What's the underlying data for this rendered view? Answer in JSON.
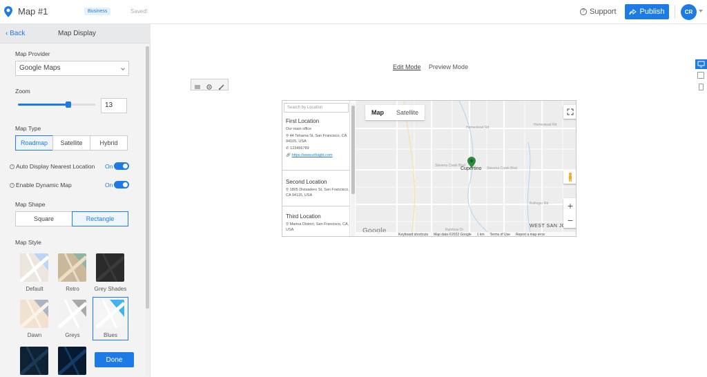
{
  "topbar": {
    "title": "Map #1",
    "badge": "Business",
    "status": "Saved!",
    "support_label": "Support",
    "publish_label": "Publish",
    "avatar_initials": "CR",
    "accent_color": "#1e7be5"
  },
  "sidebar": {
    "back_label": "‹ Back",
    "title": "Map Display",
    "map_provider_label": "Map Provider",
    "map_provider_value": "Google Maps",
    "zoom_label": "Zoom",
    "zoom_value": "13",
    "zoom_slider_fraction": 0.63,
    "map_type_label": "Map Type",
    "map_types": [
      "Roadmap",
      "Satellite",
      "Hybrid"
    ],
    "map_type_selected": "Roadmap",
    "auto_nearest_label": "Auto Display Nearest Location",
    "auto_nearest_state": "On",
    "dynamic_map_label": "Enable Dynamic Map",
    "dynamic_map_state": "On",
    "map_shape_label": "Map Shape",
    "map_shapes": [
      "Square",
      "Rectangle"
    ],
    "map_shape_selected": "Rectangle",
    "map_style_label": "Map Style",
    "styles": [
      "Default",
      "Retro",
      "Grey Shades",
      "Dawn",
      "Greys",
      "Blues"
    ],
    "style_selected": "Blues",
    "done_label": "Done"
  },
  "canvas": {
    "edit_mode_label": "Edit Mode",
    "preview_mode_label": "Preview Mode"
  },
  "locations": {
    "search_placeholder": "Search by Location",
    "items": [
      {
        "name": "First Location",
        "desc": "Our main office",
        "address": "44 Tehama St, San Francisco, CA 94105, USA",
        "phone": "123456789",
        "url": "https://www.elfsight.com"
      },
      {
        "name": "Second Location",
        "address": "1805 Divisadero St, San Francisco, CA 94115, USA"
      },
      {
        "name": "Third Location",
        "address": "Marina District, San Francisco, CA, USA"
      }
    ]
  },
  "map": {
    "map_btn": "Map",
    "satellite_btn": "Satellite",
    "marker_label": "Cupertino",
    "area_label": "WEST SAN JOSE",
    "street_labels": [
      "Stevens Creek Blvd",
      "Stevens Creek Blvd",
      "Homestead Rd",
      "Homestead Rd",
      "Bollinger Rd",
      "Rainbow Dr"
    ],
    "google": "Google",
    "attribution": [
      "Keyboard shortcuts",
      "Map data ©2022 Google",
      "1 km",
      "Terms of Use",
      "Report a map error"
    ]
  }
}
